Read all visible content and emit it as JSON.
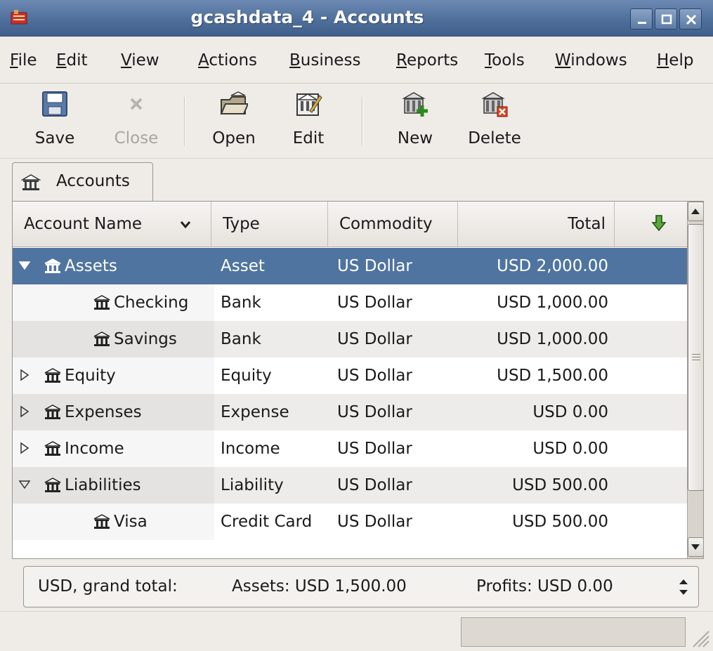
{
  "window": {
    "title": "gcashdata_4 - Accounts"
  },
  "menu": [
    {
      "pre": "",
      "u": "F",
      "post": "ile"
    },
    {
      "pre": "",
      "u": "E",
      "post": "dit"
    },
    {
      "pre": "",
      "u": "V",
      "post": "iew"
    },
    {
      "pre": "",
      "u": "A",
      "post": "ctions"
    },
    {
      "pre": "",
      "u": "B",
      "post": "usiness"
    },
    {
      "pre": "",
      "u": "R",
      "post": "eports"
    },
    {
      "pre": "",
      "u": "T",
      "post": "ools"
    },
    {
      "pre": "",
      "u": "W",
      "post": "indows"
    },
    {
      "pre": "",
      "u": "H",
      "post": "elp"
    }
  ],
  "toolbar": {
    "save": "Save",
    "close": "Close",
    "open": "Open",
    "edit": "Edit",
    "new": "New",
    "delete": "Delete"
  },
  "tab": {
    "label": "Accounts"
  },
  "columns": {
    "name": "Account Name",
    "type": "Type",
    "commodity": "Commodity",
    "total": "Total"
  },
  "rows": [
    {
      "name": "Assets",
      "type": "Asset",
      "commodity": "US Dollar",
      "total": "USD 2,000.00",
      "expander": "expanded",
      "level": 0,
      "selected": true
    },
    {
      "name": "Checking",
      "type": "Bank",
      "commodity": "US Dollar",
      "total": "USD 1,000.00",
      "expander": "none",
      "level": 1,
      "selected": false
    },
    {
      "name": "Savings",
      "type": "Bank",
      "commodity": "US Dollar",
      "total": "USD 1,000.00",
      "expander": "none",
      "level": 1,
      "selected": false
    },
    {
      "name": "Equity",
      "type": "Equity",
      "commodity": "US Dollar",
      "total": "USD 1,500.00",
      "expander": "collapsed",
      "level": 0,
      "selected": false
    },
    {
      "name": "Expenses",
      "type": "Expense",
      "commodity": "US Dollar",
      "total": "USD 0.00",
      "expander": "collapsed",
      "level": 0,
      "selected": false
    },
    {
      "name": "Income",
      "type": "Income",
      "commodity": "US Dollar",
      "total": "USD 0.00",
      "expander": "collapsed",
      "level": 0,
      "selected": false
    },
    {
      "name": "Liabilities",
      "type": "Liability",
      "commodity": "US Dollar",
      "total": "USD 500.00",
      "expander": "expanded",
      "level": 0,
      "selected": false
    },
    {
      "name": "Visa",
      "type": "Credit Card",
      "commodity": "US Dollar",
      "total": "USD 500.00",
      "expander": "none",
      "level": 1,
      "selected": false
    }
  ],
  "summary": {
    "label": "USD, grand total:",
    "assets": "Assets: USD 1,500.00",
    "profits": "Profits: USD 0.00"
  },
  "colors": {
    "selection": "#4f74a0",
    "titlebar": "#4d6d9a"
  }
}
